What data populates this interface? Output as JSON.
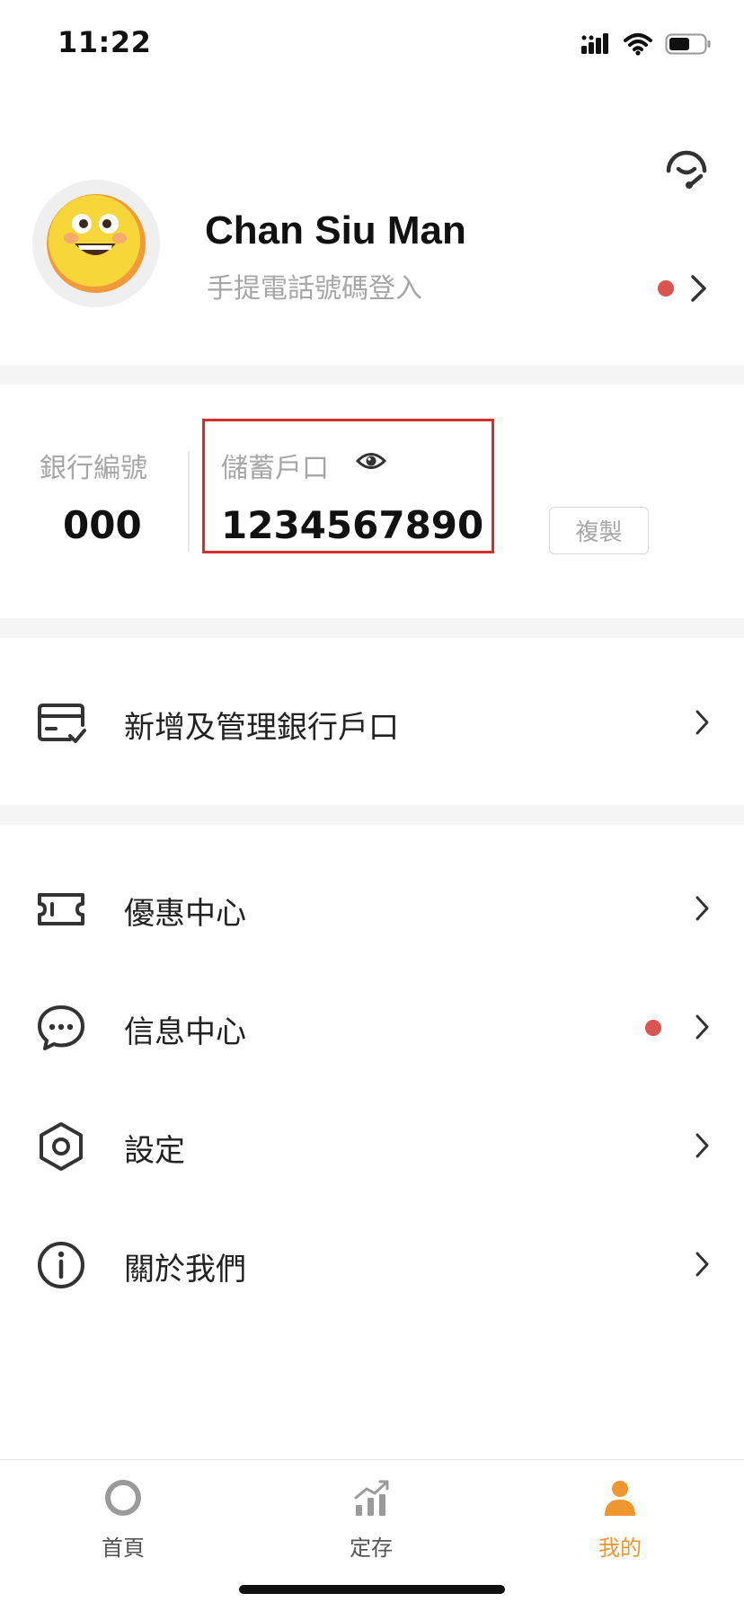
{
  "status": {
    "time": "11:22"
  },
  "profile": {
    "name": "Chan Siu Man",
    "login_method": "手提電話號碼登入"
  },
  "account": {
    "bank_code_label": "銀行編號",
    "bank_code": "000",
    "savings_label": "儲蓄戶口",
    "account_number": "1234567890",
    "copy_label": "複製"
  },
  "menu": {
    "manage_accounts": "新增及管理銀行戶口",
    "offers": "優惠中心",
    "messages": "信息中心",
    "settings": "設定",
    "about": "關於我們"
  },
  "tabs": [
    {
      "label": "首頁",
      "icon": "home-ring-icon",
      "active": false
    },
    {
      "label": "定存",
      "icon": "chart-icon",
      "active": false
    },
    {
      "label": "我的",
      "icon": "person-icon",
      "active": true
    }
  ],
  "colors": {
    "accent": "#f0962f",
    "badge": "#d9534f",
    "highlight_box": "#d32f2f",
    "muted_text": "#a6a6a6"
  }
}
